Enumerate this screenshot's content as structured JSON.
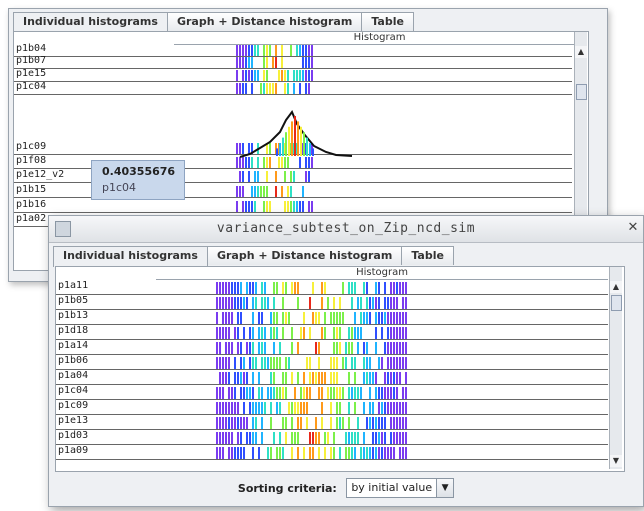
{
  "colors": {
    "spectrum": [
      "#7a3cf0",
      "#2f4fff",
      "#1fb4ff",
      "#2ee0c6",
      "#7cf04a",
      "#f7f03a",
      "#ff9a1a",
      "#e8281a"
    ]
  },
  "back": {
    "tabs": [
      "Individual histograms",
      "Graph + Distance histogram",
      "Table"
    ],
    "column_header": "Histogram",
    "rows": [
      "p1b04",
      "p1b07",
      "p1e15",
      "p1c04",
      "p1c09",
      "p1f08",
      "p1e12_v2",
      "p1b15",
      "p1b16",
      "p1a02"
    ],
    "tooltip": {
      "value": "0.40355676",
      "name": "p1c04"
    }
  },
  "front": {
    "title": "variance_subtest_on_Zip_ncd_sim",
    "tabs": [
      "Individual histograms",
      "Graph + Distance histogram",
      "Table"
    ],
    "column_header": "Histogram",
    "rows": [
      "p1a11",
      "p1b05",
      "p1b13",
      "p1d18",
      "p1a14",
      "p1b06",
      "p1a04",
      "p1c04",
      "p1c09",
      "p1e13",
      "p1d03",
      "p1a09"
    ],
    "sorting_label": "Sorting criteria:",
    "sorting_value": "by initial value"
  },
  "icons": {
    "window": "window-app-icon",
    "close": "close-icon",
    "scroll_up": "scroll-up-arrow-icon",
    "scroll_down": "scroll-down-arrow-icon",
    "dropdown": "chevron-down-icon"
  }
}
